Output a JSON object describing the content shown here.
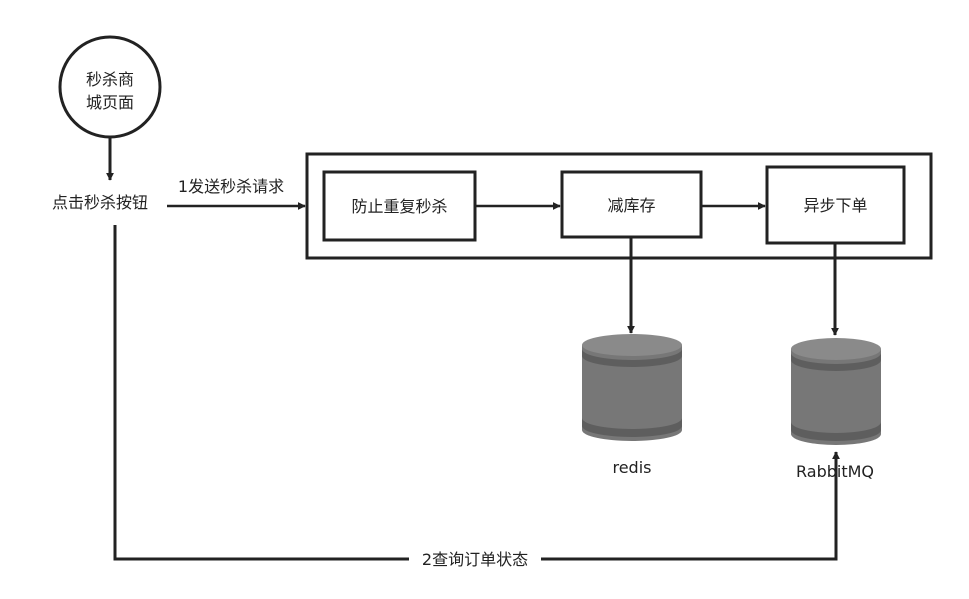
{
  "nodes": {
    "start_page": "秒杀商\n城页面",
    "click_button": "点击秒杀按钮",
    "prevent_duplicate": "防止重复秒杀",
    "reduce_stock": "减库存",
    "async_order": "异步下单",
    "redis": "redis",
    "rabbitmq": "RabbitMQ"
  },
  "edges": {
    "send_request": "1发送秒杀请求",
    "query_status": "2查询订单状态"
  },
  "colors": {
    "stroke": "#222222",
    "cylinder_body": "#777777",
    "cylinder_top": "#8a8a8a",
    "cylinder_band": "#555555"
  }
}
